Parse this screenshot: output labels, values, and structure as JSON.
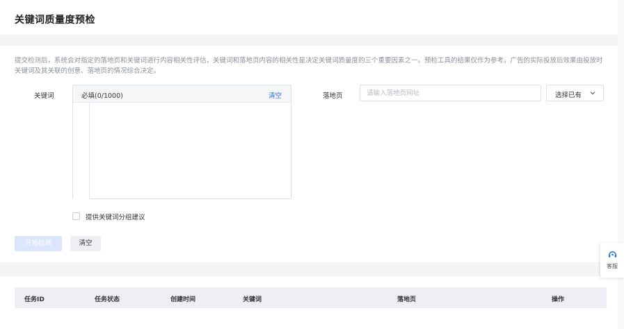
{
  "page": {
    "title": "关键词质量度预检"
  },
  "description": "提交检测后，系统会对指定的落地页和关键词进行内容相关性评估，关键词和落地页内容的相关性是决定关键词质量度的三个重要因素之一。预检工具的结果仅作为参考。广告的实际投放后效果由投放时关键词及其关联的创意、落地页的情况综合决定。",
  "keyword": {
    "label": "关键词",
    "required_hint": "必填(0/1000)",
    "clear_label": "清空",
    "value": ""
  },
  "landing_page": {
    "label": "落地页",
    "placeholder": "请输入落地页网址",
    "value": "",
    "select_label": "选择已有",
    "select_icon": "chevron-down-icon"
  },
  "group_suggestion": {
    "label": "提供关键词分组建议",
    "checked": false
  },
  "actions": {
    "start_label": "开始检测",
    "clear_label": "清空"
  },
  "table": {
    "columns": [
      "任务ID",
      "任务状态",
      "创建时间",
      "关键词",
      "落地页",
      "操作"
    ]
  },
  "support_widget": {
    "label": "客服",
    "icon": "customer-service-icon"
  },
  "colors": {
    "link": "#2b6fd6",
    "primary_disabled": "#dbe6fb",
    "page_bg": "#f4f5f7",
    "table_header_bg": "#edeff4"
  }
}
